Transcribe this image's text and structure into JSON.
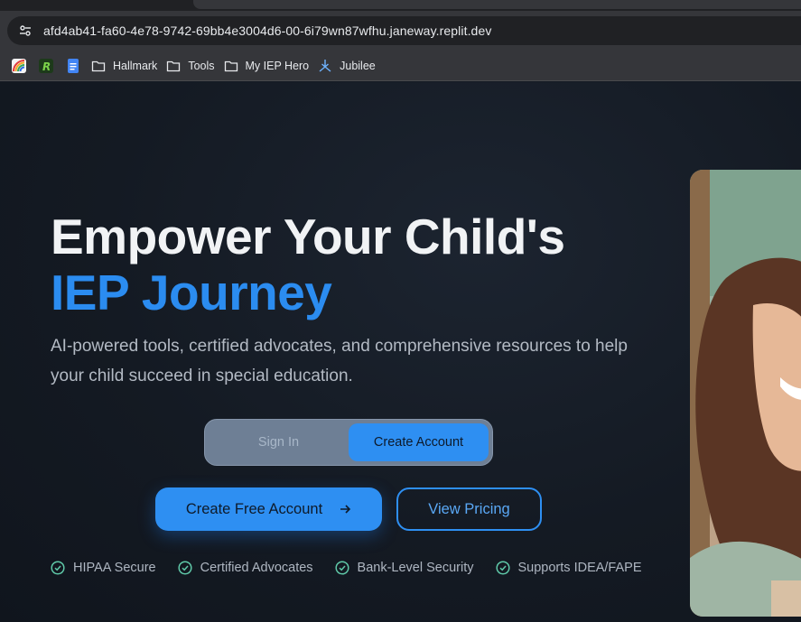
{
  "browser": {
    "url": "afd4ab41-fa60-4e78-9742-69bb4e3004d6-00-6i79wn87wfhu.janeway.replit.dev",
    "site_info_icon": "tune-icon",
    "bookmarks": [
      {
        "label": "",
        "icon": "rainbow-app-icon"
      },
      {
        "label": "",
        "icon": "r-logo-icon"
      },
      {
        "label": "",
        "icon": "google-docs-icon"
      },
      {
        "label": "Hallmark",
        "icon": "folder-icon"
      },
      {
        "label": "Tools",
        "icon": "folder-icon"
      },
      {
        "label": "My IEP Hero",
        "icon": "folder-icon"
      },
      {
        "label": "Jubilee",
        "icon": "jubilee-logo-icon"
      }
    ]
  },
  "hero": {
    "title_line1": "Empower Your Child's",
    "title_line2": "IEP Journey",
    "subtitle": "AI-powered tools, certified advocates, and comprehensive resources to help your child succeed in special education.",
    "accent_color": "#2b8cf0"
  },
  "auth_toggle": {
    "signin_label": "Sign In",
    "create_label": "Create Account",
    "selected": "Create Account"
  },
  "cta": {
    "primary_label": "Create Free Account",
    "secondary_label": "View Pricing"
  },
  "trust_badges": [
    {
      "label": "HIPAA Secure",
      "icon": "check-circle-icon"
    },
    {
      "label": "Certified Advocates",
      "icon": "check-circle-icon"
    },
    {
      "label": "Bank-Level Security",
      "icon": "check-circle-icon"
    },
    {
      "label": "Supports IDEA/FAPE",
      "icon": "check-circle-icon"
    }
  ],
  "colors": {
    "page_bg": "#141a23",
    "primary": "#2e8ff2",
    "success_check": "#5fc8a8"
  }
}
